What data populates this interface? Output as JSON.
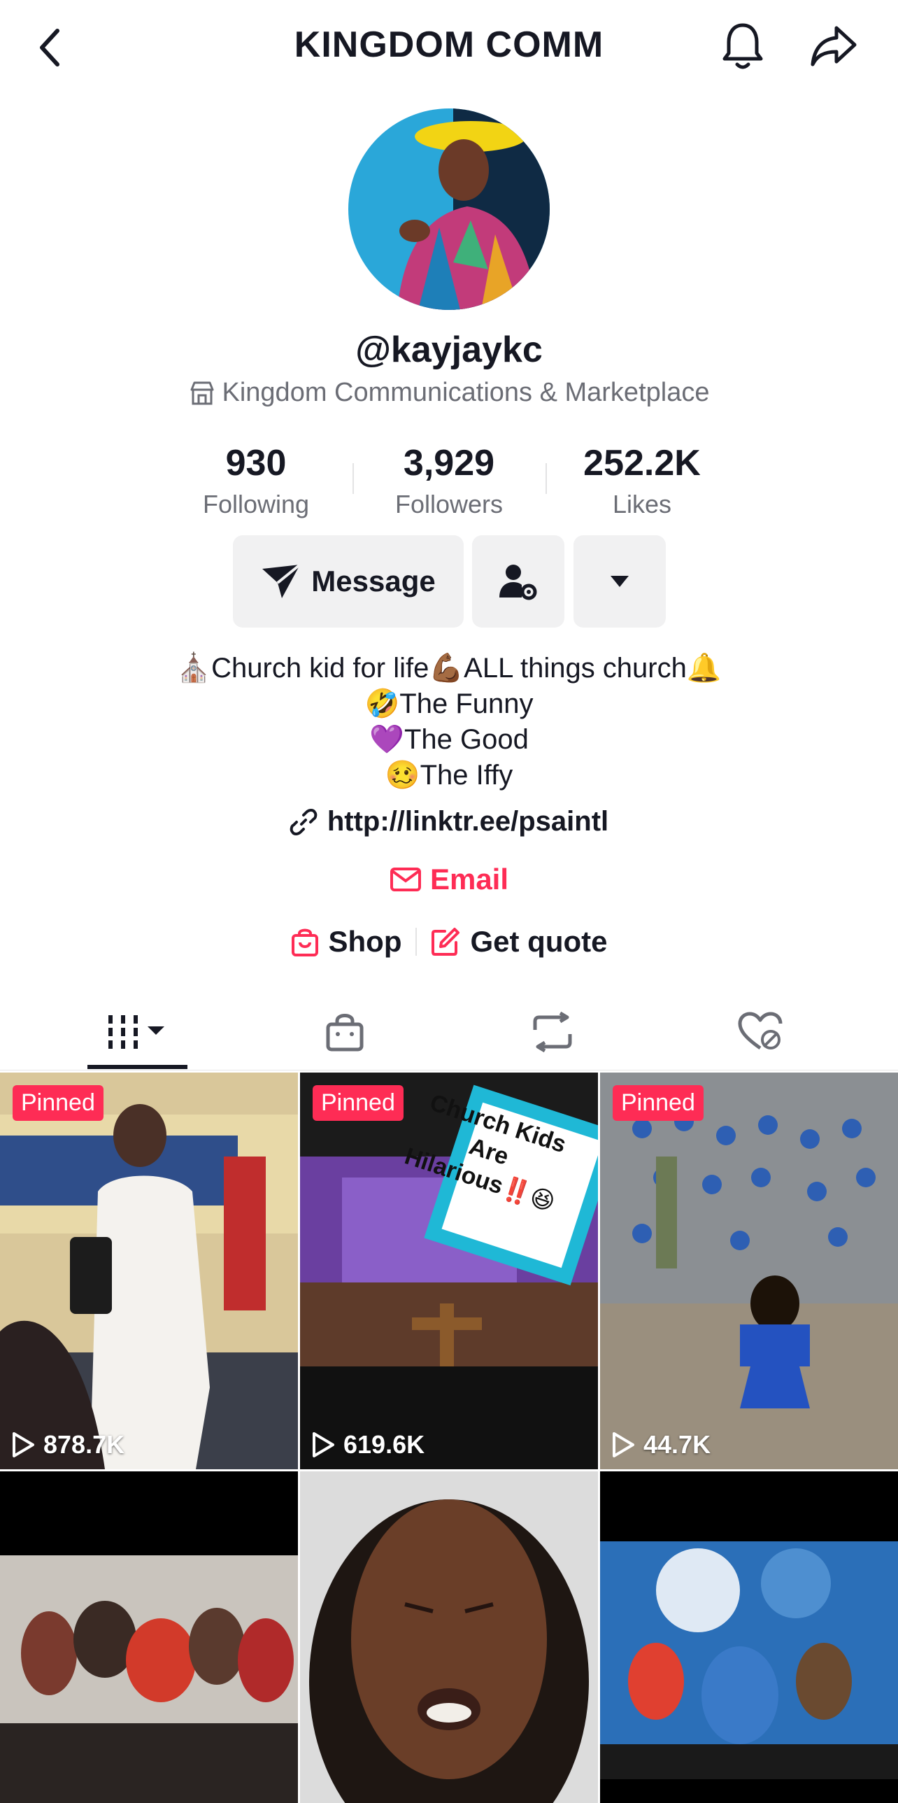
{
  "header": {
    "title": "KINGDOM COMM"
  },
  "profile": {
    "username": "@kayjaykc",
    "category": "Kingdom Communications & Marketplace"
  },
  "stats": [
    {
      "value": "930",
      "label": "Following"
    },
    {
      "value": "3,929",
      "label": "Followers"
    },
    {
      "value": "252.2K",
      "label": "Likes"
    }
  ],
  "actions": {
    "message_label": "Message"
  },
  "bio": {
    "lines": [
      "⛪Church kid for life💪🏾ALL things church🔔",
      "🤣The Funny",
      "💜The Good",
      "🥴The Iffy"
    ],
    "link": "http://linktr.ee/psaintl",
    "email_label": "Email"
  },
  "shop": {
    "shop_label": "Shop",
    "quote_label": "Get quote"
  },
  "tabs": [
    "videos-tab",
    "shop-tab",
    "reposts-tab",
    "liked-tab"
  ],
  "videos": [
    {
      "pinned": "Pinned",
      "views": "878.7K",
      "overlay_text": ""
    },
    {
      "pinned": "Pinned",
      "views": "619.6K",
      "overlay_text": "Church Kids Are Hilarious‼️😆"
    },
    {
      "pinned": "Pinned",
      "views": "44.7K",
      "overlay_text": ""
    },
    {
      "pinned": "",
      "views": "",
      "overlay_text": ""
    },
    {
      "pinned": "",
      "views": "",
      "overlay_text": ""
    },
    {
      "pinned": "",
      "views": "",
      "overlay_text": ""
    }
  ],
  "colors": {
    "accent": "#fe2c55",
    "text": "#161823",
    "muted": "#6b6d75",
    "button_bg": "#f1f1f2"
  }
}
